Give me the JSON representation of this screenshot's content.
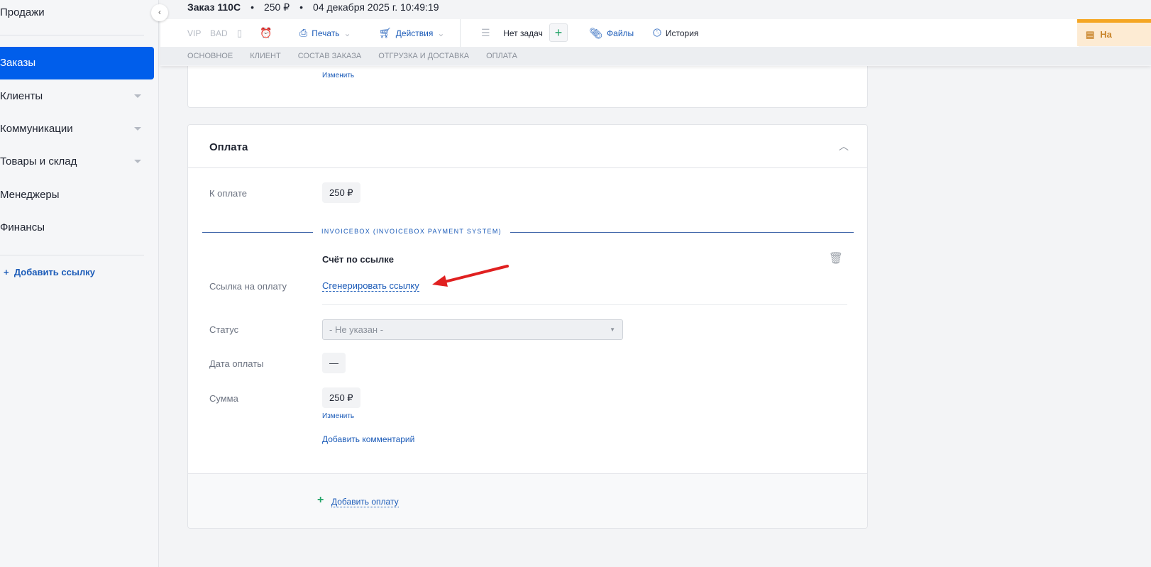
{
  "sidebar": {
    "items": [
      {
        "label": "Продажи"
      },
      {
        "label": "Заказы"
      },
      {
        "label": "Клиенты"
      },
      {
        "label": "Коммуникации"
      },
      {
        "label": "Товары и склад"
      },
      {
        "label": "Менеджеры"
      },
      {
        "label": "Финансы"
      }
    ],
    "add_link": "Добавить ссылку"
  },
  "header": {
    "order": "Заказ 110С",
    "sum": "250 ₽",
    "date": "04 декабря 2025 г. 10:49:19",
    "sep": "•"
  },
  "toolbar": {
    "vip": "VIP",
    "bad": "BAD",
    "print": "Печать",
    "actions": "Действия",
    "tasks": "Нет задач",
    "add": "+",
    "files": "Файлы",
    "history": "История",
    "note": "На"
  },
  "tabs": [
    "Основное",
    "Клиент",
    "Состав заказа",
    "Отгрузка и доставка",
    "Оплата"
  ],
  "prev_card": {
    "change": "Изменить"
  },
  "payment": {
    "title": "Оплата",
    "to_pay_label": "К оплате",
    "to_pay": "250 ₽",
    "system": "INVOICEBOX (INVOICEBOX PAYMENT SYSTEM)",
    "method": "Счёт по ссылке",
    "link_label": "Ссылка на оплату",
    "generate": "Сгенерировать ссылку",
    "status_label": "Статус",
    "status_value": "- Не указан -",
    "date_label": "Дата оплаты",
    "date_value": "—",
    "sum_label": "Сумма",
    "sum_value": "250 ₽",
    "change": "Изменить",
    "add_comment": "Добавить комментарий",
    "add_payment": "Добавить оплату"
  },
  "colors": {
    "accent": "#005eeb",
    "link": "#1b5bb8",
    "arrow": "#e02020"
  }
}
